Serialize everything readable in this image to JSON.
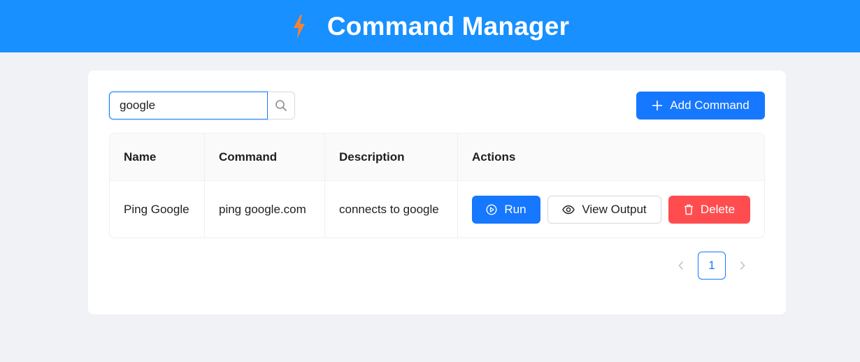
{
  "header": {
    "title": "Command Manager",
    "icon": "lightning-bolt-icon",
    "bg_color": "#1890ff",
    "icon_color": "#f58233"
  },
  "search": {
    "value": "google",
    "placeholder": "",
    "icon": "search-icon"
  },
  "toolbar": {
    "add_label": "Add Command",
    "add_icon": "plus-icon"
  },
  "table": {
    "columns": [
      "Name",
      "Command",
      "Description",
      "Actions"
    ],
    "rows": [
      {
        "name": "Ping Google",
        "command": "ping google.com",
        "description": "connects to google",
        "actions": {
          "run_label": "Run",
          "view_label": "View Output",
          "delete_label": "Delete"
        }
      }
    ]
  },
  "pagination": {
    "current_page": "1"
  },
  "colors": {
    "primary": "#1677ff",
    "danger": "#ff4d4f",
    "background": "#f0f2f5"
  }
}
